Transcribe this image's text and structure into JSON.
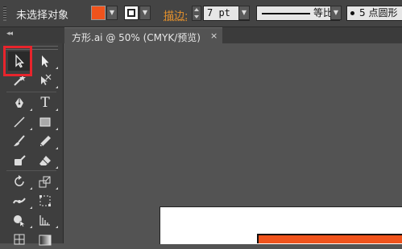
{
  "control_bar": {
    "selection_status": "未选择对象",
    "fill_color": "#f0531c",
    "stroke_label": "描边:",
    "stroke_weight": "7 pt",
    "profile_label": "等比",
    "brush_label": "5 点圆形"
  },
  "document_tab": {
    "title": "方形.ai @ 50% (CMYK/预览)",
    "close_glyph": "×"
  },
  "toolbar": {
    "collapse_glyph": "◂◂",
    "type_glyph": "T",
    "highlight_color": "#e8242c"
  },
  "canvas": {
    "background": "#535353",
    "artboard_color": "#ffffff",
    "shape_color": "#f0531c"
  }
}
